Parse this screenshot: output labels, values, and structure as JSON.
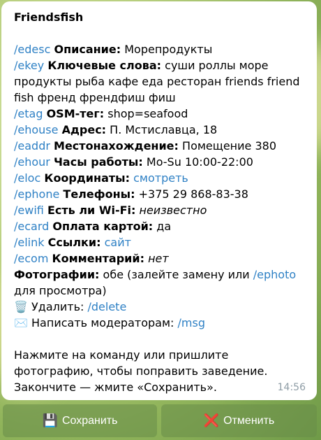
{
  "message": {
    "title": "Friendsfish",
    "rows": [
      {
        "cmd": "/edesc",
        "label": "Описание:",
        "value": "Морепродукты"
      },
      {
        "cmd": "/ekey",
        "label": "Ключевые слова:",
        "value": "суши роллы море продукты рыба кафе еда ресторан friends friend fish френд френдфиш фиш"
      },
      {
        "cmd": "/etag",
        "label": "OSM-тег:",
        "value": "shop=seafood"
      },
      {
        "cmd": "/ehouse",
        "label": "Адрес:",
        "value": "П. Мстиславца, 18"
      },
      {
        "cmd": "/eaddr",
        "label": "Местонахождение:",
        "value": "Помещение 380"
      },
      {
        "cmd": "/ehour",
        "label": "Часы работы:",
        "value": "Mo-Su 10:00-22:00"
      },
      {
        "cmd": "/eloc",
        "label": "Координаты:",
        "value": "смотреть"
      },
      {
        "cmd": "/ephone",
        "label": "Телефоны:",
        "value": "+375 29 868-83-38"
      },
      {
        "cmd": "/ewifi",
        "label": "Есть ли Wi-Fi:",
        "value": "неизвестно"
      },
      {
        "cmd": "/ecard",
        "label": "Оплата картой:",
        "value": "да"
      },
      {
        "cmd": "/elink",
        "label": "Ссылки:",
        "value": "сайт"
      },
      {
        "cmd": "/ecom",
        "label": "Комментарий:",
        "value": "нет"
      }
    ],
    "photos_label": "Фотографии:",
    "photos_text_before": "обе (залейте замену или",
    "photos_cmd": "/ephoto",
    "photos_text_after": "для просмотра)",
    "delete_icon": "🗑️",
    "delete_label": "Удалить:",
    "delete_cmd": "/delete",
    "msg_icon": "✉️",
    "msg_label": "Написать модераторам:",
    "msg_cmd": "/msg",
    "footer": "Нажмите на команду или пришлите фотографию, чтобы поправить заведение. Закончите — жмите «Сохранить».",
    "time": "14:56"
  },
  "buttons": {
    "save_icon": "💾",
    "save_label": "Сохранить",
    "cancel_icon": "❌",
    "cancel_label": "Отменить"
  }
}
